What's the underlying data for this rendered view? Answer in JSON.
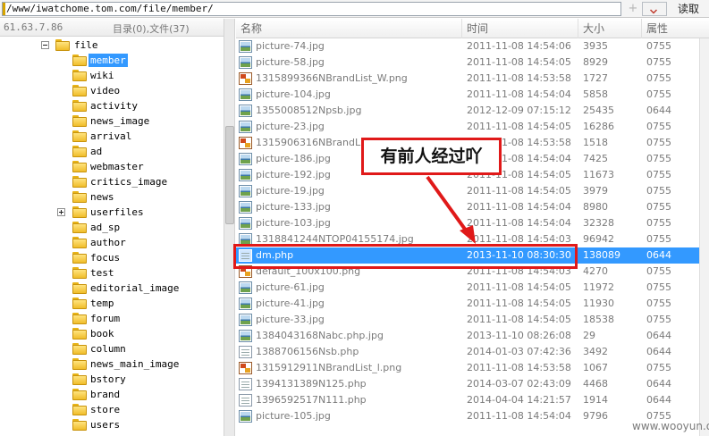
{
  "address_bar": {
    "path": "/www/iwatchome.tom.com/file/member/",
    "add_icon": "+",
    "dropdown_icon": "chevron-down",
    "read_label": "读取"
  },
  "left_panel": {
    "site_ip": "61.63.7.86",
    "dir_summary": "目录(0),文件(37)",
    "tree": [
      {
        "label": "file",
        "expander": "minus"
      },
      {
        "label": "member",
        "selected": true
      },
      {
        "label": "wiki"
      },
      {
        "label": "video"
      },
      {
        "label": "activity"
      },
      {
        "label": "news_image"
      },
      {
        "label": "arrival"
      },
      {
        "label": "ad"
      },
      {
        "label": "webmaster"
      },
      {
        "label": "critics_image"
      },
      {
        "label": "news"
      },
      {
        "label": "userfiles",
        "expander": "plus"
      },
      {
        "label": "ad_sp"
      },
      {
        "label": "author"
      },
      {
        "label": "focus"
      },
      {
        "label": "test"
      },
      {
        "label": "editorial_image"
      },
      {
        "label": "temp"
      },
      {
        "label": "forum"
      },
      {
        "label": "book"
      },
      {
        "label": "column"
      },
      {
        "label": "news_main_image"
      },
      {
        "label": "bstory"
      },
      {
        "label": "brand"
      },
      {
        "label": "store"
      },
      {
        "label": "users"
      }
    ]
  },
  "file_list": {
    "columns": {
      "name": "名称",
      "time": "时间",
      "size": "大小",
      "attr": "属性"
    },
    "rows": [
      {
        "icon": "image",
        "name": "picture-74.jpg",
        "time": "2011-11-08 14:54:06",
        "size": "3935",
        "attr": "0755"
      },
      {
        "icon": "image",
        "name": "picture-58.jpg",
        "time": "2011-11-08 14:54:05",
        "size": "8929",
        "attr": "0755"
      },
      {
        "icon": "png",
        "name": "1315899366NBrandList_W.png",
        "time": "2011-11-08 14:53:58",
        "size": "1727",
        "attr": "0755"
      },
      {
        "icon": "image",
        "name": "picture-104.jpg",
        "time": "2011-11-08 14:54:04",
        "size": "5858",
        "attr": "0755"
      },
      {
        "icon": "image",
        "name": "1355008512Npsb.jpg",
        "time": "2012-12-09 07:15:12",
        "size": "25435",
        "attr": "0644"
      },
      {
        "icon": "image",
        "name": "picture-23.jpg",
        "time": "2011-11-08 14:54:05",
        "size": "16286",
        "attr": "0755"
      },
      {
        "icon": "png",
        "name": "1315906316NBrandList_",
        "time": "2011-11-08 14:53:58",
        "size": "1518",
        "attr": "0755"
      },
      {
        "icon": "image",
        "name": "picture-186.jpg",
        "time": "2011-11-08 14:54:04",
        "size": "7425",
        "attr": "0755"
      },
      {
        "icon": "image",
        "name": "picture-192.jpg",
        "time": "2011-11-08 14:54:05",
        "size": "11673",
        "attr": "0755"
      },
      {
        "icon": "image",
        "name": "picture-19.jpg",
        "time": "2011-11-08 14:54:05",
        "size": "3979",
        "attr": "0755"
      },
      {
        "icon": "image",
        "name": "picture-133.jpg",
        "time": "2011-11-08 14:54:04",
        "size": "8980",
        "attr": "0755"
      },
      {
        "icon": "image",
        "name": "picture-103.jpg",
        "time": "2011-11-08 14:54:04",
        "size": "32328",
        "attr": "0755"
      },
      {
        "icon": "image",
        "name": "1318841244NTOP04155174.jpg",
        "time": "2011-11-08 14:54:03",
        "size": "96942",
        "attr": "0755"
      },
      {
        "icon": "php",
        "name": "dm.php",
        "time": "2013-11-10 08:30:30",
        "size": "138089",
        "attr": "0644",
        "selected": true
      },
      {
        "icon": "png",
        "name": "default_100x100.png",
        "time": "2011-11-08 14:54:03",
        "size": "4270",
        "attr": "0755"
      },
      {
        "icon": "image",
        "name": "picture-61.jpg",
        "time": "2011-11-08 14:54:05",
        "size": "11972",
        "attr": "0755"
      },
      {
        "icon": "image",
        "name": "picture-41.jpg",
        "time": "2011-11-08 14:54:05",
        "size": "11930",
        "attr": "0755"
      },
      {
        "icon": "image",
        "name": "picture-33.jpg",
        "time": "2011-11-08 14:54:05",
        "size": "18538",
        "attr": "0755"
      },
      {
        "icon": "image",
        "name": "1384043168Nabc.php.jpg",
        "time": "2013-11-10 08:26:08",
        "size": "29",
        "attr": "0644"
      },
      {
        "icon": "php",
        "name": "1388706156Nsb.php",
        "time": "2014-01-03 07:42:36",
        "size": "3492",
        "attr": "0644"
      },
      {
        "icon": "png",
        "name": "1315912911NBrandList_l.png",
        "time": "2011-11-08 14:53:58",
        "size": "1067",
        "attr": "0755"
      },
      {
        "icon": "php",
        "name": "1394131389N125.php",
        "time": "2014-03-07 02:43:09",
        "size": "4468",
        "attr": "0644"
      },
      {
        "icon": "php",
        "name": "1396592517N111.php",
        "time": "2014-04-04 14:21:57",
        "size": "1914",
        "attr": "0644"
      },
      {
        "icon": "image",
        "name": "picture-105.jpg",
        "time": "2011-11-08 14:54:04",
        "size": "9796",
        "attr": "0755"
      }
    ]
  },
  "annotation": {
    "text": "有前人经过吖",
    "color": "#e01919"
  },
  "watermark": "www.wooyun.org",
  "colors": {
    "selection": "#3399ff"
  }
}
